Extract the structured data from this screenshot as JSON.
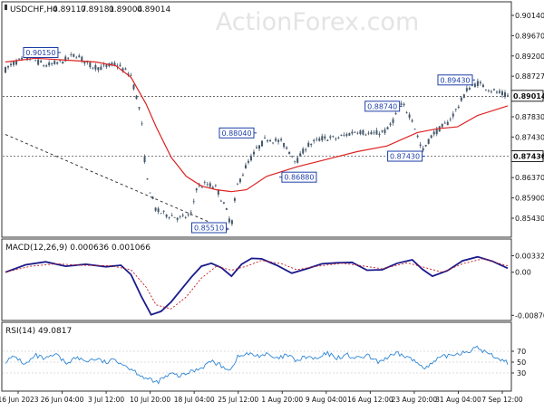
{
  "chart_data": [
    {
      "type": "candlestick",
      "panel": "price",
      "header": {
        "symbol": "USDCHF,H4",
        "open": "0.89117",
        "high": "0.89181",
        "low": "0.89004",
        "close": "0.89014"
      },
      "watermark": "ActionForex.com",
      "ylim": [
        0.854,
        0.911
      ],
      "yticks": [
        "0.90140",
        "0.89670",
        "0.89200",
        "0.88727",
        "0.88260",
        "0.87830",
        "0.87430",
        "0.86847",
        "0.86370",
        "0.85900",
        "0.85430"
      ],
      "xticks": [
        "16 Jun 2023",
        "26 Jun 04:00",
        "3 Jul 12:00",
        "10 Jul 20:00",
        "18 Jul 04:00",
        "25 Jul 12:00",
        "1 Aug 20:00",
        "9 Aug 04:00",
        "16 Aug 12:00",
        "23 Aug 20:00",
        "31 Aug 04:00",
        "7 Sep 12:00"
      ],
      "current_price": "0.89014",
      "reference_lines": [
        {
          "value": 0.89,
          "label": ""
        },
        {
          "value": 0.8743,
          "label": "0.87430"
        }
      ],
      "trendline": {
        "from": [
          0,
          0.88
        ],
        "to": [
          0.445,
          0.8548
        ]
      },
      "price_path": [
        [
          0.0,
          0.897
        ],
        [
          0.02,
          0.899
        ],
        [
          0.05,
          0.9
        ],
        [
          0.08,
          0.898
        ],
        [
          0.11,
          0.899
        ],
        [
          0.14,
          0.901
        ],
        [
          0.17,
          0.898
        ],
        [
          0.19,
          0.8975
        ],
        [
          0.22,
          0.8985
        ],
        [
          0.25,
          0.8955
        ],
        [
          0.27,
          0.885
        ],
        [
          0.28,
          0.869
        ],
        [
          0.3,
          0.86
        ],
        [
          0.32,
          0.859
        ],
        [
          0.35,
          0.858
        ],
        [
          0.37,
          0.859
        ],
        [
          0.38,
          0.866
        ],
        [
          0.4,
          0.867
        ],
        [
          0.42,
          0.866
        ],
        [
          0.44,
          0.86
        ],
        [
          0.45,
          0.856
        ],
        [
          0.46,
          0.866
        ],
        [
          0.48,
          0.872
        ],
        [
          0.5,
          0.876
        ],
        [
          0.52,
          0.879
        ],
        [
          0.55,
          0.878
        ],
        [
          0.58,
          0.873
        ],
        [
          0.6,
          0.877
        ],
        [
          0.63,
          0.879
        ],
        [
          0.66,
          0.879
        ],
        [
          0.7,
          0.881
        ],
        [
          0.73,
          0.88
        ],
        [
          0.76,
          0.881
        ],
        [
          0.79,
          0.888
        ],
        [
          0.81,
          0.884
        ],
        [
          0.83,
          0.8755
        ],
        [
          0.85,
          0.88
        ],
        [
          0.88,
          0.883
        ],
        [
          0.9,
          0.887
        ],
        [
          0.92,
          0.892
        ],
        [
          0.94,
          0.8935
        ],
        [
          0.97,
          0.8915
        ],
        [
          1.0,
          0.89
        ]
      ],
      "series": [
        {
          "name": "",
          "color": "#dc2222",
          "values": [
            [
              0.0,
              0.899
            ],
            [
              0.06,
              0.9
            ],
            [
              0.12,
              0.8995
            ],
            [
              0.18,
              0.899
            ],
            [
              0.22,
              0.898
            ],
            [
              0.25,
              0.895
            ],
            [
              0.28,
              0.888
            ],
            [
              0.3,
              0.882
            ],
            [
              0.33,
              0.874
            ],
            [
              0.36,
              0.869
            ],
            [
              0.39,
              0.8665
            ],
            [
              0.42,
              0.8655
            ],
            [
              0.45,
              0.865
            ],
            [
              0.48,
              0.8655
            ],
            [
              0.52,
              0.869
            ],
            [
              0.58,
              0.8715
            ],
            [
              0.64,
              0.8735
            ],
            [
              0.7,
              0.8755
            ],
            [
              0.76,
              0.877
            ],
            [
              0.82,
              0.8805
            ],
            [
              0.86,
              0.8815
            ],
            [
              0.9,
              0.882
            ],
            [
              0.94,
              0.885
            ],
            [
              1.0,
              0.8875
            ]
          ]
        }
      ],
      "annotations": [
        {
          "label": "0.90150",
          "at": [
            0.11,
            0.9015
          ],
          "side": "left"
        },
        {
          "label": "0.85510",
          "at": [
            0.445,
            0.8551
          ],
          "side": "left"
        },
        {
          "label": "0.88040",
          "at": [
            0.5,
            0.8804
          ],
          "side": "left"
        },
        {
          "label": "0.86880",
          "at": [
            0.545,
            0.8688
          ],
          "side": "right"
        },
        {
          "label": "0.88740",
          "at": [
            0.79,
            0.8874
          ],
          "side": "left"
        },
        {
          "label": "0.87430",
          "at": [
            0.835,
            0.8743
          ],
          "side": "left"
        },
        {
          "label": "0.89430",
          "at": [
            0.935,
            0.8943
          ],
          "side": "left"
        }
      ]
    },
    {
      "type": "line",
      "panel": "macd",
      "header": "MACD(12,26,9) 0.000636 0.001066",
      "ylim": [
        -0.0092,
        0.0036
      ],
      "yticks": [
        "0.003328",
        "0.00",
        "-0.008707"
      ],
      "series": [
        {
          "name": "",
          "color": "#1a1a8c",
          "values": [
            [
              0.0,
              0.0
            ],
            [
              0.04,
              0.0015
            ],
            [
              0.08,
              0.0021
            ],
            [
              0.12,
              0.0012
            ],
            [
              0.16,
              0.0016
            ],
            [
              0.2,
              0.0011
            ],
            [
              0.23,
              0.0014
            ],
            [
              0.25,
              -0.0005
            ],
            [
              0.27,
              -0.0048
            ],
            [
              0.29,
              -0.0086
            ],
            [
              0.31,
              -0.0079
            ],
            [
              0.33,
              -0.006
            ],
            [
              0.35,
              -0.0035
            ],
            [
              0.37,
              -0.001
            ],
            [
              0.39,
              0.0012
            ],
            [
              0.41,
              0.0018
            ],
            [
              0.43,
              0.0009
            ],
            [
              0.45,
              -0.0008
            ],
            [
              0.47,
              0.0016
            ],
            [
              0.49,
              0.0028
            ],
            [
              0.51,
              0.0027
            ],
            [
              0.54,
              0.0014
            ],
            [
              0.57,
              -0.0002
            ],
            [
              0.6,
              0.0007
            ],
            [
              0.63,
              0.0017
            ],
            [
              0.66,
              0.0019
            ],
            [
              0.69,
              0.002
            ],
            [
              0.72,
              0.0004
            ],
            [
              0.75,
              0.0005
            ],
            [
              0.78,
              0.0018
            ],
            [
              0.81,
              0.0025
            ],
            [
              0.83,
              0.0006
            ],
            [
              0.85,
              -0.0008
            ],
            [
              0.88,
              0.0003
            ],
            [
              0.91,
              0.0023
            ],
            [
              0.94,
              0.0031
            ],
            [
              0.97,
              0.0022
            ],
            [
              1.0,
              0.0008
            ]
          ]
        },
        {
          "name": "",
          "color": "#c41818",
          "dashed": true,
          "values": [
            [
              0.0,
              0.0
            ],
            [
              0.05,
              0.0012
            ],
            [
              0.1,
              0.0017
            ],
            [
              0.15,
              0.0014
            ],
            [
              0.21,
              0.0013
            ],
            [
              0.25,
              0.0005
            ],
            [
              0.28,
              -0.003
            ],
            [
              0.3,
              -0.0066
            ],
            [
              0.33,
              -0.0074
            ],
            [
              0.36,
              -0.005
            ],
            [
              0.39,
              -0.0012
            ],
            [
              0.42,
              0.0012
            ],
            [
              0.45,
              0.0004
            ],
            [
              0.48,
              0.0012
            ],
            [
              0.51,
              0.0024
            ],
            [
              0.55,
              0.0017
            ],
            [
              0.58,
              0.0005
            ],
            [
              0.62,
              0.0012
            ],
            [
              0.67,
              0.0018
            ],
            [
              0.71,
              0.0013
            ],
            [
              0.75,
              0.0007
            ],
            [
              0.8,
              0.0019
            ],
            [
              0.84,
              0.0008
            ],
            [
              0.87,
              0.0
            ],
            [
              0.91,
              0.0017
            ],
            [
              0.95,
              0.0027
            ],
            [
              1.0,
              0.0013
            ]
          ]
        }
      ]
    },
    {
      "type": "line",
      "panel": "rsi",
      "header": "RSI(14) 49.0817",
      "ylim": [
        0,
        100
      ],
      "yticks": [
        "70",
        "50",
        "30"
      ],
      "guides": [
        70,
        50,
        30
      ],
      "series": [
        {
          "name": "RSI(14)",
          "color": "#2f86d6",
          "values": [
            [
              0.0,
              52
            ],
            [
              0.02,
              60
            ],
            [
              0.04,
              45
            ],
            [
              0.06,
              62
            ],
            [
              0.08,
              55
            ],
            [
              0.1,
              64
            ],
            [
              0.12,
              48
            ],
            [
              0.14,
              58
            ],
            [
              0.16,
              52
            ],
            [
              0.18,
              56
            ],
            [
              0.2,
              49
            ],
            [
              0.22,
              55
            ],
            [
              0.24,
              43
            ],
            [
              0.26,
              32
            ],
            [
              0.28,
              20
            ],
            [
              0.3,
              12
            ],
            [
              0.31,
              18
            ],
            [
              0.33,
              28
            ],
            [
              0.35,
              24
            ],
            [
              0.37,
              33
            ],
            [
              0.39,
              40
            ],
            [
              0.41,
              52
            ],
            [
              0.43,
              43
            ],
            [
              0.45,
              36
            ],
            [
              0.46,
              58
            ],
            [
              0.48,
              65
            ],
            [
              0.5,
              62
            ],
            [
              0.52,
              64
            ],
            [
              0.54,
              55
            ],
            [
              0.56,
              63
            ],
            [
              0.58,
              52
            ],
            [
              0.6,
              60
            ],
            [
              0.62,
              55
            ],
            [
              0.64,
              66
            ],
            [
              0.66,
              58
            ],
            [
              0.68,
              63
            ],
            [
              0.7,
              56
            ],
            [
              0.72,
              62
            ],
            [
              0.74,
              50
            ],
            [
              0.76,
              58
            ],
            [
              0.78,
              65
            ],
            [
              0.8,
              60
            ],
            [
              0.82,
              48
            ],
            [
              0.84,
              40
            ],
            [
              0.86,
              55
            ],
            [
              0.88,
              62
            ],
            [
              0.9,
              66
            ],
            [
              0.92,
              70
            ],
            [
              0.94,
              76
            ],
            [
              0.96,
              66
            ],
            [
              0.98,
              58
            ],
            [
              1.0,
              49
            ]
          ]
        }
      ]
    }
  ]
}
